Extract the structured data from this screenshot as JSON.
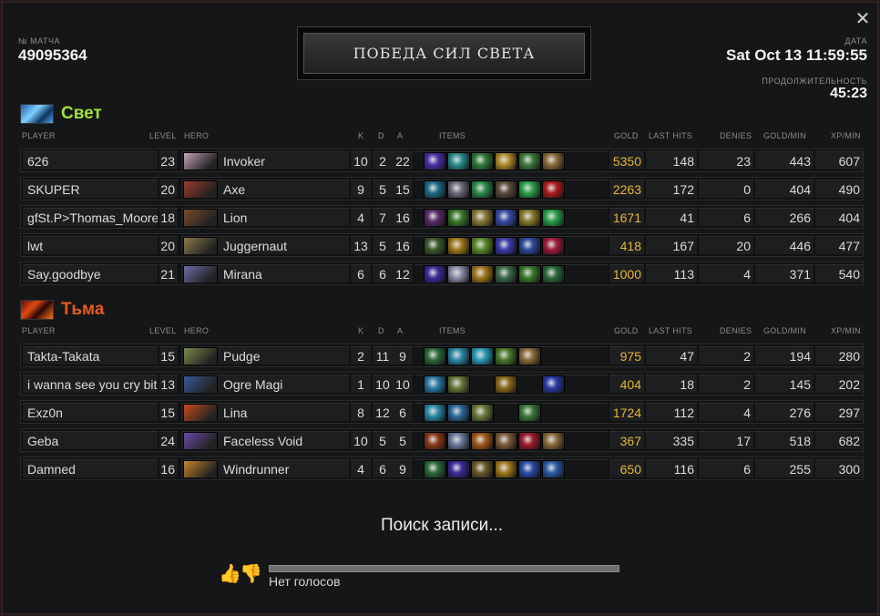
{
  "header": {
    "match_label": "№ МАТЧА",
    "match_id": "49095364",
    "result": "ПОБЕДА СИЛ СВЕТА",
    "date_label": "ДАТА",
    "date": "Sat Oct 13 11:59:55",
    "duration_label": "ПРОДОЛЖИТЕЛЬНОСТЬ",
    "duration": "45:23"
  },
  "columns": {
    "player": "PLAYER",
    "level": "LEVEL",
    "hero": "HERO",
    "k": "K",
    "d": "D",
    "a": "A",
    "items": "ITEMS",
    "gold": "GOLD",
    "last_hits": "LAST HITS",
    "denies": "DENIES",
    "gpm": "GOLD/MIN",
    "xpm": "XP/MIN"
  },
  "radiant": {
    "name": "Свет",
    "color": "#9fe13a",
    "players": [
      {
        "player": "626",
        "level": "23",
        "hero": "Invoker",
        "k": "10",
        "d": "2",
        "a": "22",
        "gold": "5350",
        "lh": "148",
        "den": "23",
        "gpm": "443",
        "xpm": "607",
        "hero_color": "#c8a0b8",
        "items": [
          "#4b2fa8",
          "#2a8c8c",
          "#2f7a3a",
          "#b08a2a",
          "#3a7a3a",
          "#8a6a3a"
        ]
      },
      {
        "player": "SKUPER",
        "level": "20",
        "hero": "Axe",
        "k": "9",
        "d": "5",
        "a": "15",
        "gold": "2263",
        "lh": "172",
        "den": "0",
        "gpm": "404",
        "xpm": "490",
        "hero_color": "#9a3a2a",
        "items": [
          "#1e6a8a",
          "#6a6a7a",
          "#2a8a4a",
          "#5a4a3a",
          "#2aa04a",
          "#b01a1a"
        ]
      },
      {
        "player": "gfSt.P>Thomas_Moore",
        "level": "18",
        "hero": "Lion",
        "k": "4",
        "d": "7",
        "a": "16",
        "gold": "1671",
        "lh": "41",
        "den": "6",
        "gpm": "266",
        "xpm": "404",
        "hero_color": "#7a4a2a",
        "items": [
          "#5a2a6a",
          "#3a7a2a",
          "#8a7a3a",
          "#3a4aa8",
          "#8a7a2a",
          "#2aa04a"
        ]
      },
      {
        "player": "lwt",
        "level": "20",
        "hero": "Juggernaut",
        "k": "13",
        "d": "5",
        "a": "16",
        "gold": "418",
        "lh": "167",
        "den": "20",
        "gpm": "446",
        "xpm": "477",
        "hero_color": "#8a7a4a",
        "items": [
          "#3a5a2a",
          "#a0781a",
          "#5a8a2a",
          "#3a3aa8",
          "#2a4a9a",
          "#a01a3a"
        ]
      },
      {
        "player": "Say.goodbye",
        "level": "21",
        "hero": "Mirana",
        "k": "6",
        "d": "6",
        "a": "12",
        "gold": "1000",
        "lh": "113",
        "den": "4",
        "gpm": "371",
        "xpm": "540",
        "hero_color": "#6a6aa8",
        "items": [
          "#3a2a9a",
          "#8a8aa8",
          "#a0781a",
          "#3a6a4a",
          "#3a7a2a",
          "#2a6a3a"
        ]
      }
    ]
  },
  "dire": {
    "name": "Тьма",
    "color": "#e85a1e",
    "players": [
      {
        "player": "Takta-Takata",
        "level": "15",
        "hero": "Pudge",
        "k": "2",
        "d": "11",
        "a": "9",
        "gold": "975",
        "lh": "47",
        "den": "2",
        "gpm": "194",
        "xpm": "280",
        "hero_color": "#7a8a4a",
        "items": [
          "#2a6a3a",
          "#2a8aa8",
          "#2a9ab8",
          "#4a7a2a",
          "#8a6a3a",
          ""
        ]
      },
      {
        "player": "i wanna see you cry bitch",
        "level": "13",
        "hero": "Ogre Magi",
        "k": "1",
        "d": "10",
        "a": "10",
        "gold": "404",
        "lh": "18",
        "den": "2",
        "gpm": "145",
        "xpm": "202",
        "hero_color": "#3a5a9a",
        "items": [
          "#2a7aa8",
          "#6a7a3a",
          "",
          "#8a6a1a",
          "",
          "#2a3aa8"
        ]
      },
      {
        "player": "Exz0n",
        "level": "15",
        "hero": "Lina",
        "k": "8",
        "d": "12",
        "a": "6",
        "gold": "1724",
        "lh": "112",
        "den": "4",
        "gpm": "276",
        "xpm": "297",
        "hero_color": "#c84a1a",
        "items": [
          "#2a8aa8",
          "#2a6a9a",
          "#6a7a3a",
          "",
          "#3a7a3a",
          ""
        ]
      },
      {
        "player": "Geba",
        "level": "24",
        "hero": "Faceless Void",
        "k": "10",
        "d": "5",
        "a": "5",
        "gold": "367",
        "lh": "335",
        "den": "17",
        "gpm": "518",
        "xpm": "682",
        "hero_color": "#6a4aa8",
        "items": [
          "#8a3a1a",
          "#6a7a9a",
          "#a05a1a",
          "#7a5a3a",
          "#a01a2a",
          "#8a6a3a"
        ]
      },
      {
        "player": "Damned",
        "level": "16",
        "hero": "Windrunner",
        "k": "4",
        "d": "6",
        "a": "9",
        "gold": "650",
        "lh": "116",
        "den": "6",
        "gpm": "255",
        "xpm": "300",
        "hero_color": "#c8842a",
        "items": [
          "#2a6a3a",
          "#3a2a9a",
          "#6a5a2a",
          "#a0781a",
          "#2a4aa8",
          "#2a5aa8"
        ]
      }
    ]
  },
  "footer": {
    "searching": "Поиск записи...",
    "votes": "Нет голосов",
    "thumb_up_icon": "thumbs-up-icon",
    "thumb_down_icon": "thumbs-down-icon"
  }
}
